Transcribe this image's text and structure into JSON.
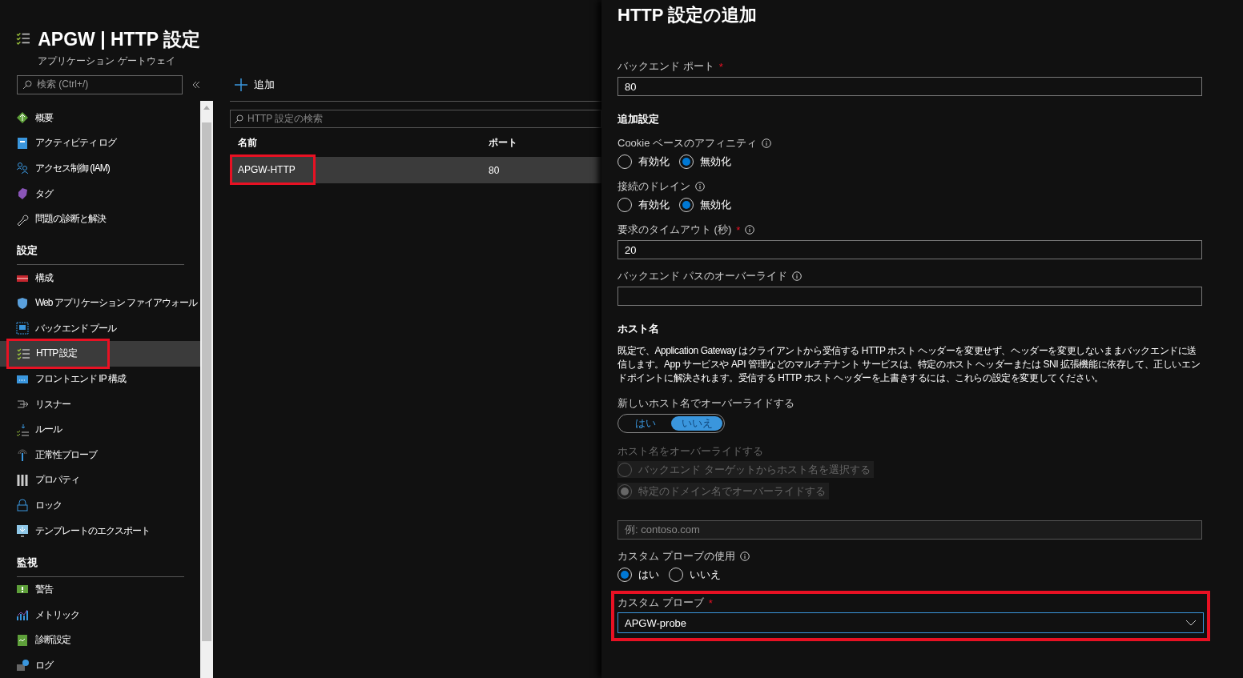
{
  "header": {
    "title": "APGW | HTTP 設定",
    "subtitle": "アプリケーション ゲートウェイ"
  },
  "sidebar": {
    "search_placeholder": "検索 (Ctrl+/)",
    "sections": [
      {
        "items": [
          {
            "label": "概要",
            "selected": false,
            "highlighted": false
          },
          {
            "label": "アクティビティ ログ",
            "selected": false,
            "highlighted": false
          },
          {
            "label": "アクセス制御 (IAM)",
            "selected": false,
            "highlighted": false
          },
          {
            "label": "タグ",
            "selected": false,
            "highlighted": false
          },
          {
            "label": "問題の診断と解決",
            "selected": false,
            "highlighted": false
          }
        ]
      },
      {
        "heading": "設定",
        "items": [
          {
            "label": "構成",
            "selected": false,
            "highlighted": false
          },
          {
            "label": "Web アプリケーション ファイアウォール",
            "selected": false,
            "highlighted": false
          },
          {
            "label": "バックエンド プール",
            "selected": false,
            "highlighted": false
          },
          {
            "label": "HTTP 設定",
            "selected": true,
            "highlighted": true
          },
          {
            "label": "フロントエンド IP 構成",
            "selected": false,
            "highlighted": false
          },
          {
            "label": "リスナー",
            "selected": false,
            "highlighted": false
          },
          {
            "label": "ルール",
            "selected": false,
            "highlighted": false
          },
          {
            "label": "正常性プローブ",
            "selected": false,
            "highlighted": false
          },
          {
            "label": "プロパティ",
            "selected": false,
            "highlighted": false
          },
          {
            "label": "ロック",
            "selected": false,
            "highlighted": false
          },
          {
            "label": "テンプレートのエクスポート",
            "selected": false,
            "highlighted": false
          }
        ]
      },
      {
        "heading": "監視",
        "items": [
          {
            "label": "警告",
            "selected": false,
            "highlighted": false
          },
          {
            "label": "メトリック",
            "selected": false,
            "highlighted": false
          },
          {
            "label": "診断設定",
            "selected": false,
            "highlighted": false
          },
          {
            "label": "ログ",
            "selected": false,
            "highlighted": false
          }
        ]
      }
    ]
  },
  "list": {
    "add_label": "追加",
    "search_placeholder": "HTTP 設定の検索",
    "columns": [
      "名前",
      "ポート"
    ],
    "rows": [
      {
        "cells": [
          "APGW-HTTP",
          "80"
        ],
        "selected": true,
        "highlighted": true
      }
    ]
  },
  "panel": {
    "title": "HTTP 設定の追加",
    "fields": [
      {
        "kind": "text",
        "label": "バックエンド ポート",
        "required_mark": "*",
        "value": "80"
      },
      {
        "kind": "heading",
        "text": "追加設定"
      },
      {
        "kind": "radio",
        "label": "Cookie ベースのアフィニティ",
        "info": true,
        "options": [
          {
            "label": "有効化",
            "selected": false
          },
          {
            "label": "無効化",
            "selected": true
          }
        ]
      },
      {
        "kind": "radio",
        "label": "接続のドレイン",
        "info": true,
        "options": [
          {
            "label": "有効化",
            "selected": false
          },
          {
            "label": "無効化",
            "selected": true
          }
        ]
      },
      {
        "kind": "text",
        "label": "要求のタイムアウト (秒)",
        "required_mark": "*",
        "info": true,
        "value": "20"
      },
      {
        "kind": "text",
        "label": "バックエンド パスのオーバーライド",
        "info": true
      },
      {
        "kind": "heading",
        "text": "ホスト名"
      },
      {
        "kind": "paragraph",
        "text": "既定で、Application Gateway はクライアントから受信する HTTP ホスト ヘッダーを変更せず、ヘッダーを変更しないままバックエンドに送信します。App サービスや API 管理などのマルチテナント サービスは、特定のホスト ヘッダーまたは SNI 拡張機能に依存して、正しいエンドポイントに解決されます。受信する HTTP ホスト ヘッダーを上書きするには、これらの設定を変更してください。"
      },
      {
        "kind": "toggle",
        "label": "新しいホスト名でオーバーライドする",
        "options": [
          {
            "label": "はい",
            "selected": false
          },
          {
            "label": "いいえ",
            "selected": true
          }
        ]
      },
      {
        "kind": "radio",
        "label": "ホスト名をオーバーライドする",
        "disabled": true,
        "options": [
          {
            "label": "バックエンド ターゲットからホスト名を選択する",
            "selected": false
          },
          {
            "label": "特定のドメイン名でオーバーライドする",
            "selected": true
          }
        ]
      },
      {
        "kind": "text",
        "disabled": true,
        "placeholder": "例: contoso.com"
      },
      {
        "kind": "radio",
        "label": "カスタム プローブの使用",
        "info": true,
        "options": [
          {
            "label": "はい",
            "selected": true
          },
          {
            "label": "いいえ",
            "selected": false
          }
        ]
      },
      {
        "kind": "select",
        "label": "カスタム プローブ",
        "required_mark": "*",
        "value": "APGW-probe",
        "highlighted": true
      }
    ]
  }
}
